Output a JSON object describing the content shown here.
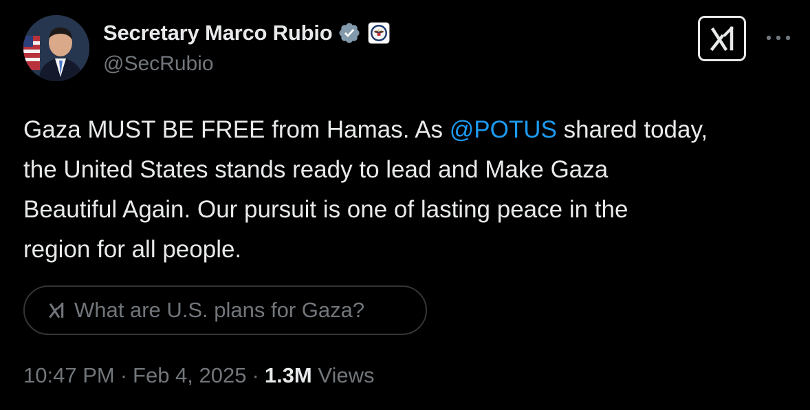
{
  "author": {
    "display_name": "Secretary Marco Rubio",
    "handle": "@SecRubio",
    "verified_icon": "verified-badge-icon",
    "affiliate_icon": "state-department-seal-icon",
    "avatar_icon": "profile-avatar"
  },
  "header_actions": {
    "grok_icon": "grok-icon",
    "more_icon": "more-horizontal-icon"
  },
  "tweet": {
    "text_lines": [
      {
        "before": "Gaza MUST BE FREE from Hamas. As ",
        "mention": "@POTUS",
        "after": " shared today,"
      },
      {
        "text": "the United States stands ready to lead and Make Gaza"
      },
      {
        "text": "Beautiful Again. Our pursuit is one of lasting peace in the"
      },
      {
        "text": "region for all people."
      }
    ]
  },
  "grok_prompt": {
    "label": "What are U.S. plans for Gaza?",
    "icon": "grok-icon"
  },
  "meta": {
    "time": "10:47 PM",
    "separator": "·",
    "date": "Feb 4, 2025",
    "views_count": "1.3M",
    "views_label": "Views"
  },
  "colors": {
    "background": "#000000",
    "text_primary": "#e7e9ea",
    "text_secondary": "#71767b",
    "link": "#1d9bf0",
    "verified_badge": "#829aab",
    "border": "#333639"
  }
}
